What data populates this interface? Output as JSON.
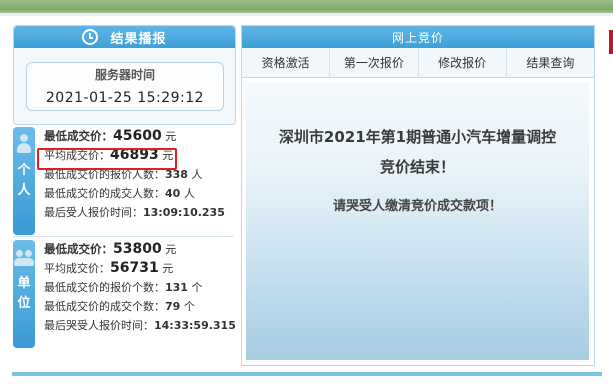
{
  "results": {
    "title": "结果播报",
    "server_label": "服务器时间",
    "server_time": "2021-01-25 15:29:12"
  },
  "personal": {
    "tab_chars": [
      "个",
      "人"
    ],
    "min_price_label": "最低成交价：",
    "min_price": "45600",
    "min_price_unit": "元",
    "avg_price_label": "平均成交价：",
    "avg_price": "46893",
    "avg_price_unit": "元",
    "min_bidders_label": "最低成交价的报价人数：",
    "min_bidders": "338",
    "min_bidders_unit": "人",
    "min_winners_label": "最低成交价的成交人数：",
    "min_winners": "40",
    "min_winners_unit": "人",
    "last_time_label": "最后受人报价时间：",
    "last_time": "13:09:10.235"
  },
  "company": {
    "tab_chars": [
      "单",
      "位"
    ],
    "min_price_label": "最低成交价：",
    "min_price": "53800",
    "min_price_unit": "元",
    "avg_price_label": "平均成交价：",
    "avg_price": "56731",
    "avg_price_unit": "元",
    "min_bidders_label": "最低成交价的报价个数：",
    "min_bidders": "131",
    "min_bidders_unit": "个",
    "min_winners_label": "最低成交价的成交个数：",
    "min_winners": "79",
    "min_winners_unit": "个",
    "last_time_label": "最后哭受人报价时间：",
    "last_time": "14:33:59.315"
  },
  "online": {
    "title": "网上竞价",
    "tabs": [
      "资格激活",
      "第一次报价",
      "修改报价",
      "结果查询"
    ],
    "message_line1": "深圳市2021年第1期普通小汽车增量调控",
    "message_line2": "竞价结束！",
    "message_line3": "请哭受人缴清竞价成交款项！"
  },
  "icons": {
    "results": "clock-icon",
    "personal": "person-icon",
    "company": "group-icon"
  },
  "colors": {
    "header_blue": "#3c9fd7",
    "highlight_red": "#e02020"
  }
}
